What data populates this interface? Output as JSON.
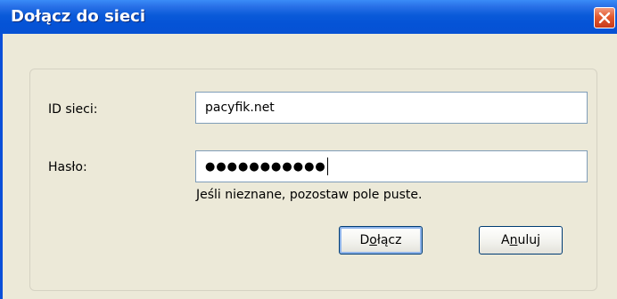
{
  "window": {
    "title": "Dołącz do sieci",
    "close_icon": "close-icon"
  },
  "form": {
    "network_id_label": "ID sieci:",
    "network_id_value": "pacyfik.net",
    "password_label": "Hasło:",
    "password_mask": "●●●●●●●●●●●",
    "hint": "Jeśli nieznane, pozostaw pole puste."
  },
  "buttons": {
    "join_prefix": "D",
    "join_mnemonic": "o",
    "join_suffix": "łącz",
    "cancel_prefix": "A",
    "cancel_mnemonic": "n",
    "cancel_suffix": "uluj"
  },
  "colors": {
    "titlebar": "#0553d6",
    "dialog_bg": "#ece9d8",
    "close_button": "#e35a2e",
    "input_border": "#7f9db9",
    "button_border": "#003c74"
  }
}
